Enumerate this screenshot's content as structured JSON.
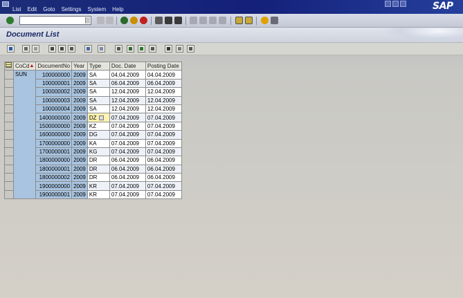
{
  "menu": [
    "List",
    "Edit",
    "Goto",
    "Settings",
    "System",
    "Help"
  ],
  "logo": "SAP",
  "page_title": "Document List",
  "grid": {
    "columns": [
      "CoCd",
      "DocumentNo",
      "Year",
      "Type",
      "Doc. Date",
      "Posting Date"
    ],
    "company_code": "SUN",
    "rows": [
      {
        "docno": "100000000",
        "year": "2009",
        "type": "SA",
        "doc_date": "04.04.2009",
        "post_date": "04.04.2009"
      },
      {
        "docno": "100000001",
        "year": "2009",
        "type": "SA",
        "doc_date": "06.04.2009",
        "post_date": "06.04.2009"
      },
      {
        "docno": "100000002",
        "year": "2009",
        "type": "SA",
        "doc_date": "12.04.2009",
        "post_date": "12.04.2009"
      },
      {
        "docno": "100000003",
        "year": "2009",
        "type": "SA",
        "doc_date": "12.04.2009",
        "post_date": "12.04.2009"
      },
      {
        "docno": "100000004",
        "year": "2009",
        "type": "SA",
        "doc_date": "12.04.2009",
        "post_date": "12.04.2009"
      },
      {
        "docno": "1400000000",
        "year": "2009",
        "type": "DZ",
        "doc_date": "07.04.2009",
        "post_date": "07.04.2009"
      },
      {
        "docno": "1500000000",
        "year": "2009",
        "type": "KZ",
        "doc_date": "07.04.2009",
        "post_date": "07.04.2009"
      },
      {
        "docno": "1600000000",
        "year": "2009",
        "type": "DG",
        "doc_date": "07.04.2009",
        "post_date": "07.04.2009"
      },
      {
        "docno": "1700000000",
        "year": "2009",
        "type": "KA",
        "doc_date": "07.04.2009",
        "post_date": "07.04.2009"
      },
      {
        "docno": "1700000001",
        "year": "2009",
        "type": "KG",
        "doc_date": "07.04.2009",
        "post_date": "07.04.2009"
      },
      {
        "docno": "1800000000",
        "year": "2009",
        "type": "DR",
        "doc_date": "06.04.2009",
        "post_date": "06.04.2009"
      },
      {
        "docno": "1800000001",
        "year": "2009",
        "type": "DR",
        "doc_date": "06.04.2009",
        "post_date": "06.04.2009"
      },
      {
        "docno": "1800000002",
        "year": "2009",
        "type": "DR",
        "doc_date": "06.04.2009",
        "post_date": "06.04.2009"
      },
      {
        "docno": "1900000000",
        "year": "2009",
        "type": "KR",
        "doc_date": "07.04.2009",
        "post_date": "07.04.2009"
      },
      {
        "docno": "1900000001",
        "year": "2009",
        "type": "KR",
        "doc_date": "07.04.2009",
        "post_date": "07.04.2009"
      }
    ]
  },
  "colors": {
    "title_blue": "#1a2a66",
    "key_column": "#a8c4e0",
    "focus_cell": "#fff3b0"
  }
}
